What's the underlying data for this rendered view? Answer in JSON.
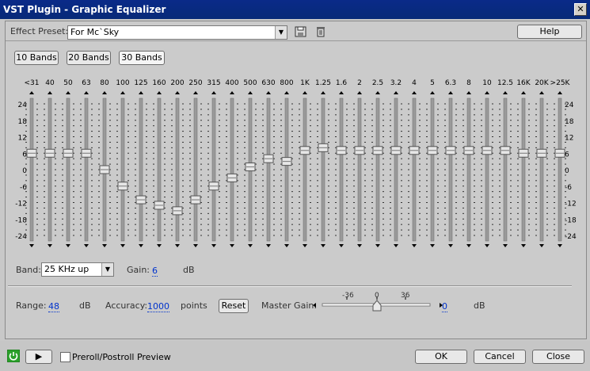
{
  "window": {
    "title": "VST Plugin - Graphic Equalizer",
    "close_glyph": "✕"
  },
  "preset": {
    "label": "Effect Preset:",
    "value": "For Mc`Sky"
  },
  "help_label": "Help",
  "band_buttons": [
    "10 Bands",
    "20 Bands",
    "30 Bands"
  ],
  "selected_band_count": "30 Bands",
  "bands": [
    "<31",
    "40",
    "50",
    "63",
    "80",
    "100",
    "125",
    "160",
    "200",
    "250",
    "315",
    "400",
    "500",
    "630",
    "800",
    "1K",
    "1.25",
    "1.6",
    "2",
    "2.5",
    "3.2",
    "4",
    "5",
    "6.3",
    "8",
    "10",
    "12.5",
    "16K",
    "20K",
    ">25K"
  ],
  "gains_db": [
    6,
    6,
    6,
    6,
    0,
    -6,
    -11,
    -13,
    -15,
    -11,
    -6,
    -3,
    1,
    4,
    3,
    7,
    8,
    7,
    7,
    7,
    7,
    7,
    7,
    7,
    7,
    7,
    7,
    6,
    6,
    6
  ],
  "scale_labels": [
    "24",
    "18",
    "12",
    "6",
    "0",
    "-6",
    "-12",
    "-18",
    "-24"
  ],
  "band_select": {
    "label": "Band:",
    "value": "25 KHz up"
  },
  "gain": {
    "label": "Gain:",
    "value": "6",
    "unit": "dB"
  },
  "range": {
    "label": "Range:",
    "value": "48",
    "unit": "dB"
  },
  "accuracy": {
    "label": "Accuracy:",
    "value": "1000",
    "unit": "points"
  },
  "reset_label": "Reset",
  "master_gain": {
    "label": "Master Gain:",
    "value": "0",
    "unit": "dB",
    "ticks": [
      "-36",
      "0",
      "36"
    ],
    "level": 0
  },
  "preroll_label": "Preroll/Postroll Preview",
  "ok_label": "OK",
  "cancel_label": "Cancel",
  "close_label": "Close",
  "colors": {
    "titlebar": "#0a2a88",
    "link_blue": "#0033cc",
    "power_green": "#2aa02a"
  }
}
